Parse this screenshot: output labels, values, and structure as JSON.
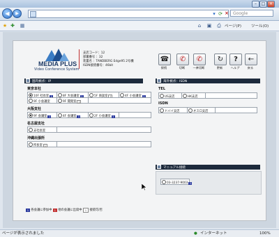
{
  "browser": {
    "search_placeholder": "Google",
    "fav_tools": [
      "ページ(P)",
      "ツール(O)"
    ],
    "status_left": "ページが表示されました",
    "status_zone": "インターネット",
    "zoom": "100%"
  },
  "header": {
    "logo_title": "MEDIA PLUS",
    "logo_sub": "Video Conference System",
    "info": [
      "支店コード：12",
      "部署番号 ：32",
      "装置名 ：TANDBERG Edge95 2号機",
      "ISDN接続番号：46bit"
    ]
  },
  "toolbar": [
    {
      "label": "接続",
      "icon": "phone-connect-icon",
      "glyph": "☎"
    },
    {
      "label": "切断",
      "icon": "phone-hangup-icon",
      "glyph": "✆"
    },
    {
      "label": "一斉切断",
      "icon": "phone-all-hangup-icon",
      "glyph": "✆"
    },
    {
      "label": "更新",
      "icon": "refresh-icon",
      "glyph": "↻"
    },
    {
      "label": "ヘルプ",
      "icon": "help-icon",
      "glyph": "?"
    },
    {
      "label": "戻る",
      "icon": "back-icon",
      "glyph": "←"
    }
  ],
  "ip_panel": {
    "title": "国内拠点：IP",
    "groups": [
      {
        "name": "東京本社",
        "rows": [
          [
            "10F 社長室",
            "8F 大会議室",
            "5F 商談室",
            "4F 小会議室"
          ],
          [
            "9F 小会議室",
            "9F 開発室"
          ]
        ]
      },
      {
        "name": "大阪支社",
        "rows": [
          [
            "9F 会議室",
            "4F 会議室",
            "2F 小会議室"
          ]
        ]
      },
      {
        "name": "名古屋支社",
        "rows": [
          [
            "支社長室"
          ]
        ]
      },
      {
        "name": "沖縄出張所",
        "rows": [
          [
            "所長室"
          ]
        ]
      }
    ]
  },
  "isdn_panel": {
    "title": "海外拠点：ISDN",
    "groups": [
      {
        "name": "TEL",
        "rows": [
          [
            "US支店",
            "HK支店"
          ]
        ]
      },
      {
        "name": "ISDN",
        "rows": [
          [
            "ドバイ支店",
            "オスロ支店"
          ]
        ]
      }
    ]
  },
  "manual_panel": {
    "title": "マニュアル接続",
    "number": "03-3237-9003"
  },
  "legend": {
    "items": [
      {
        "badge": "1",
        "text": "各会議に参加中"
      },
      {
        "badge": "1",
        "text": "他の会議に出席中"
      },
      {
        "badge": "1",
        "text": "接続可/否"
      }
    ]
  },
  "colors": {
    "badge_blue": "#2b3a9e",
    "badge_red": "#c23030",
    "header_dark": "#1d2a3c"
  }
}
